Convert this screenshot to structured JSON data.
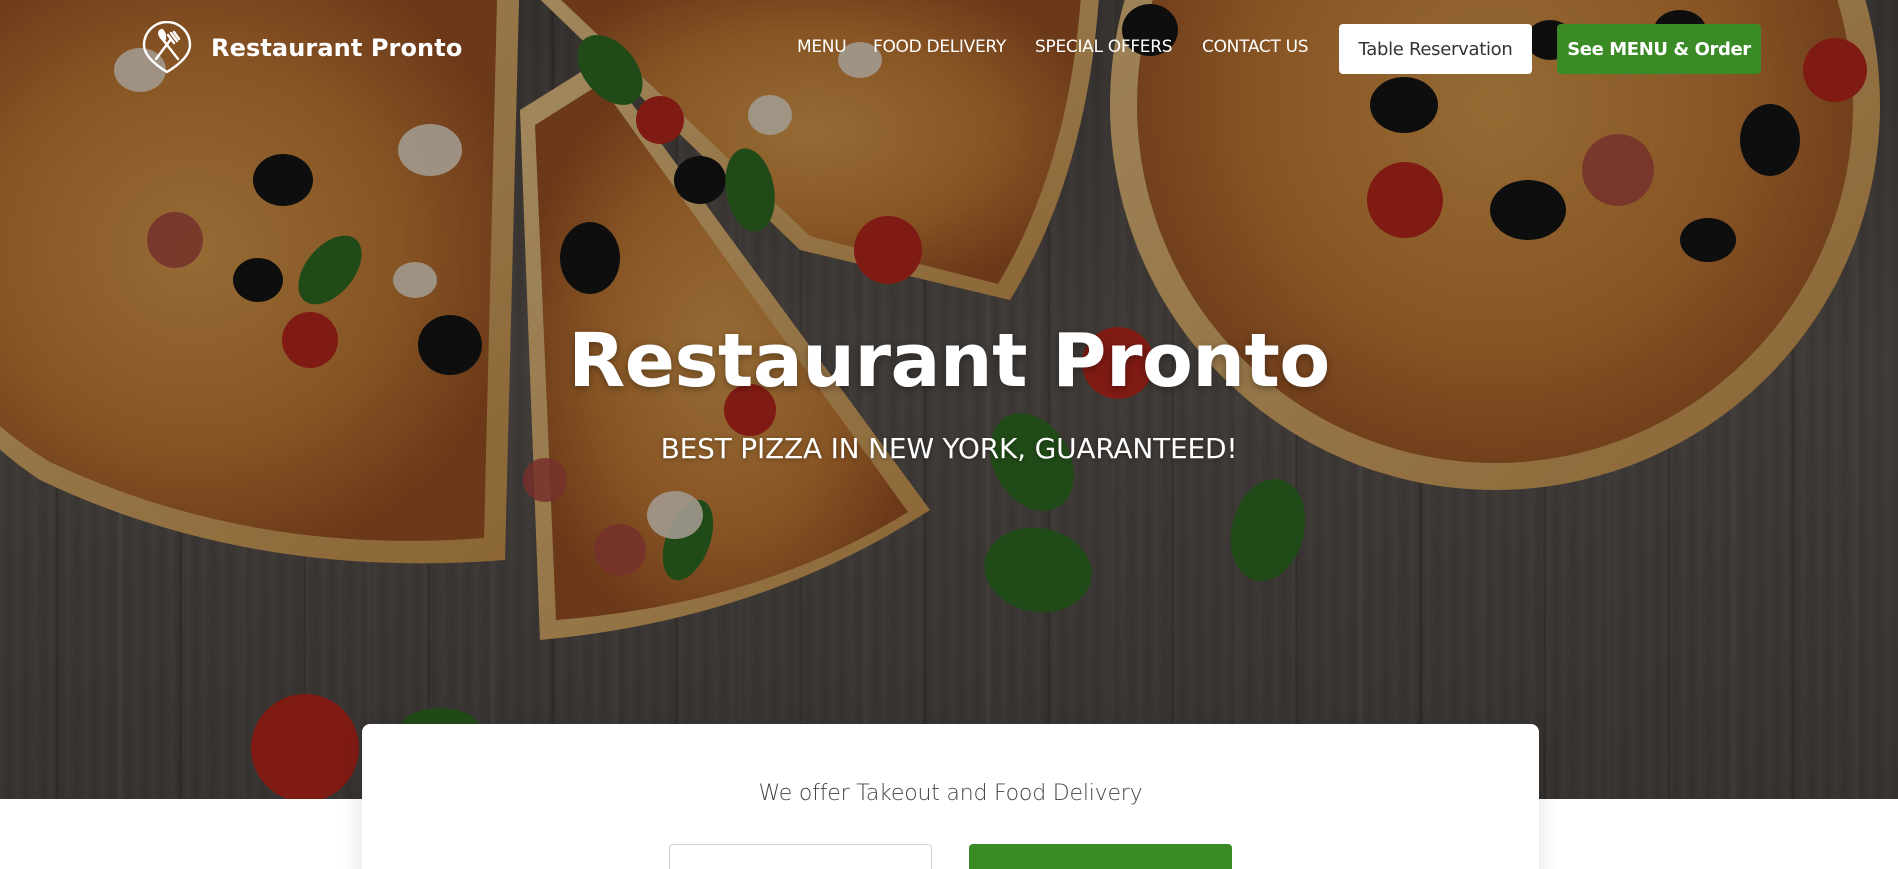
{
  "brand": {
    "name": "Restaurant Pronto",
    "logo_icon": "fork-knife-icon"
  },
  "nav": {
    "links": [
      {
        "label": "MENU"
      },
      {
        "label": "FOOD DELIVERY"
      },
      {
        "label": "SPECIAL OFFERS"
      },
      {
        "label": "CONTACT US"
      }
    ],
    "reserve_button": "Table Reservation",
    "order_button": "See MENU & Order"
  },
  "hero": {
    "title": "Restaurant Pronto",
    "subtitle": "BEST PIZZA IN NEW YORK, GUARANTEED!",
    "background": "pizza-on-wooden-table-photo"
  },
  "offer": {
    "title": "We offer Takeout and Food Delivery",
    "input_value": "",
    "button_label": ""
  },
  "colors": {
    "accent_green": "#3a8a25",
    "white": "#ffffff",
    "text_dark": "#333333",
    "text_muted": "#444444"
  }
}
